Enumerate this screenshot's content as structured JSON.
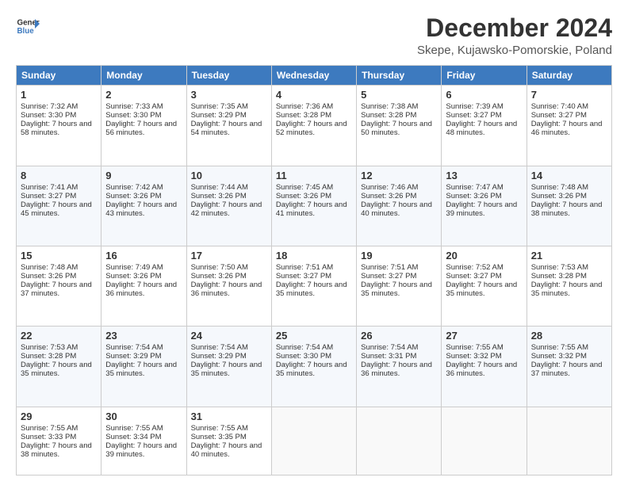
{
  "header": {
    "logo_line1": "General",
    "logo_line2": "Blue",
    "month": "December 2024",
    "location": "Skepe, Kujawsko-Pomorskie, Poland"
  },
  "days_of_week": [
    "Sunday",
    "Monday",
    "Tuesday",
    "Wednesday",
    "Thursday",
    "Friday",
    "Saturday"
  ],
  "weeks": [
    [
      {
        "day": "1",
        "rise": "7:32 AM",
        "set": "3:30 PM",
        "daylight": "7 hours and 58 minutes."
      },
      {
        "day": "2",
        "rise": "7:33 AM",
        "set": "3:30 PM",
        "daylight": "7 hours and 56 minutes."
      },
      {
        "day": "3",
        "rise": "7:35 AM",
        "set": "3:29 PM",
        "daylight": "7 hours and 54 minutes."
      },
      {
        "day": "4",
        "rise": "7:36 AM",
        "set": "3:28 PM",
        "daylight": "7 hours and 52 minutes."
      },
      {
        "day": "5",
        "rise": "7:38 AM",
        "set": "3:28 PM",
        "daylight": "7 hours and 50 minutes."
      },
      {
        "day": "6",
        "rise": "7:39 AM",
        "set": "3:27 PM",
        "daylight": "7 hours and 48 minutes."
      },
      {
        "day": "7",
        "rise": "7:40 AM",
        "set": "3:27 PM",
        "daylight": "7 hours and 46 minutes."
      }
    ],
    [
      {
        "day": "8",
        "rise": "7:41 AM",
        "set": "3:27 PM",
        "daylight": "7 hours and 45 minutes."
      },
      {
        "day": "9",
        "rise": "7:42 AM",
        "set": "3:26 PM",
        "daylight": "7 hours and 43 minutes."
      },
      {
        "day": "10",
        "rise": "7:44 AM",
        "set": "3:26 PM",
        "daylight": "7 hours and 42 minutes."
      },
      {
        "day": "11",
        "rise": "7:45 AM",
        "set": "3:26 PM",
        "daylight": "7 hours and 41 minutes."
      },
      {
        "day": "12",
        "rise": "7:46 AM",
        "set": "3:26 PM",
        "daylight": "7 hours and 40 minutes."
      },
      {
        "day": "13",
        "rise": "7:47 AM",
        "set": "3:26 PM",
        "daylight": "7 hours and 39 minutes."
      },
      {
        "day": "14",
        "rise": "7:48 AM",
        "set": "3:26 PM",
        "daylight": "7 hours and 38 minutes."
      }
    ],
    [
      {
        "day": "15",
        "rise": "7:48 AM",
        "set": "3:26 PM",
        "daylight": "7 hours and 37 minutes."
      },
      {
        "day": "16",
        "rise": "7:49 AM",
        "set": "3:26 PM",
        "daylight": "7 hours and 36 minutes."
      },
      {
        "day": "17",
        "rise": "7:50 AM",
        "set": "3:26 PM",
        "daylight": "7 hours and 36 minutes."
      },
      {
        "day": "18",
        "rise": "7:51 AM",
        "set": "3:27 PM",
        "daylight": "7 hours and 35 minutes."
      },
      {
        "day": "19",
        "rise": "7:51 AM",
        "set": "3:27 PM",
        "daylight": "7 hours and 35 minutes."
      },
      {
        "day": "20",
        "rise": "7:52 AM",
        "set": "3:27 PM",
        "daylight": "7 hours and 35 minutes."
      },
      {
        "day": "21",
        "rise": "7:53 AM",
        "set": "3:28 PM",
        "daylight": "7 hours and 35 minutes."
      }
    ],
    [
      {
        "day": "22",
        "rise": "7:53 AM",
        "set": "3:28 PM",
        "daylight": "7 hours and 35 minutes."
      },
      {
        "day": "23",
        "rise": "7:54 AM",
        "set": "3:29 PM",
        "daylight": "7 hours and 35 minutes."
      },
      {
        "day": "24",
        "rise": "7:54 AM",
        "set": "3:29 PM",
        "daylight": "7 hours and 35 minutes."
      },
      {
        "day": "25",
        "rise": "7:54 AM",
        "set": "3:30 PM",
        "daylight": "7 hours and 35 minutes."
      },
      {
        "day": "26",
        "rise": "7:54 AM",
        "set": "3:31 PM",
        "daylight": "7 hours and 36 minutes."
      },
      {
        "day": "27",
        "rise": "7:55 AM",
        "set": "3:32 PM",
        "daylight": "7 hours and 36 minutes."
      },
      {
        "day": "28",
        "rise": "7:55 AM",
        "set": "3:32 PM",
        "daylight": "7 hours and 37 minutes."
      }
    ],
    [
      {
        "day": "29",
        "rise": "7:55 AM",
        "set": "3:33 PM",
        "daylight": "7 hours and 38 minutes."
      },
      {
        "day": "30",
        "rise": "7:55 AM",
        "set": "3:34 PM",
        "daylight": "7 hours and 39 minutes."
      },
      {
        "day": "31",
        "rise": "7:55 AM",
        "set": "3:35 PM",
        "daylight": "7 hours and 40 minutes."
      },
      null,
      null,
      null,
      null
    ]
  ]
}
